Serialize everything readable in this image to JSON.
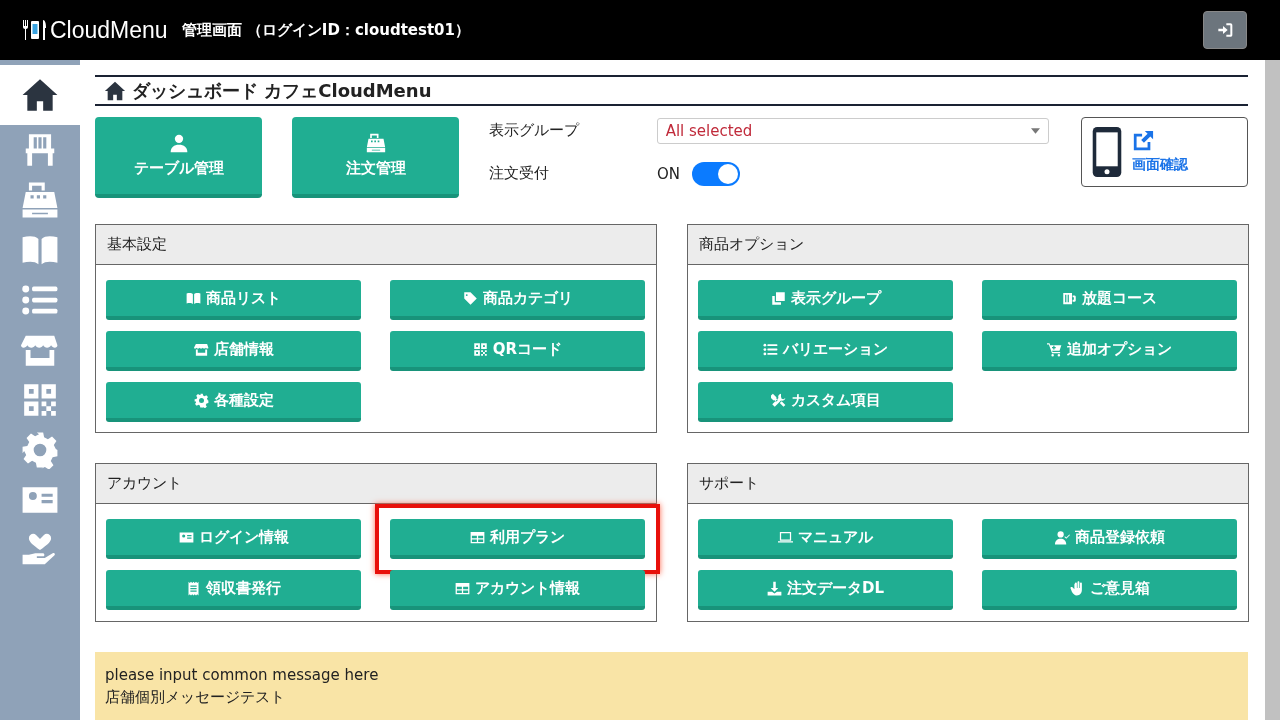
{
  "header": {
    "logo": "CloudMenu",
    "title": "管理画面 （ログインID：cloudtest01）"
  },
  "sidebar": {
    "items": [
      {
        "kind": "home",
        "selected": true
      },
      {
        "kind": "chair",
        "selected": false
      },
      {
        "kind": "register",
        "selected": false
      },
      {
        "kind": "book",
        "selected": false
      },
      {
        "kind": "list",
        "selected": false
      },
      {
        "kind": "store",
        "selected": false
      },
      {
        "kind": "qr",
        "selected": false
      },
      {
        "kind": "gear",
        "selected": false
      },
      {
        "kind": "idcard",
        "selected": false
      },
      {
        "kind": "heart",
        "selected": false
      }
    ]
  },
  "page_title": "ダッシュボード カフェCloudMenu",
  "quick_buttons": [
    {
      "kind": "user",
      "label": "テーブル管理"
    },
    {
      "kind": "register",
      "label": "注文管理"
    }
  ],
  "display_group": {
    "label": "表示グループ",
    "value": "All selected"
  },
  "order_accept": {
    "label": "注文受付",
    "state_text": "ON",
    "on": true
  },
  "preview": {
    "label": "画面確認"
  },
  "panels": [
    {
      "title": "基本設定",
      "buttons": [
        {
          "kind": "book",
          "label": "商品リスト",
          "highlighted": false
        },
        {
          "kind": "tag",
          "label": "商品カテゴリ",
          "highlighted": false
        },
        {
          "kind": "store",
          "label": "店舗情報",
          "highlighted": false
        },
        {
          "kind": "qr",
          "label": "QRコード",
          "highlighted": false
        },
        {
          "kind": "gear",
          "label": "各種設定",
          "highlighted": false
        }
      ]
    },
    {
      "title": "商品オプション",
      "buttons": [
        {
          "kind": "clone",
          "label": "表示グループ",
          "highlighted": false
        },
        {
          "kind": "mug",
          "label": "放題コース",
          "highlighted": false
        },
        {
          "kind": "list",
          "label": "バリエーション",
          "highlighted": false
        },
        {
          "kind": "cart",
          "label": "追加オプション",
          "highlighted": false
        },
        {
          "kind": "tools",
          "label": "カスタム項目",
          "highlighted": false
        }
      ]
    },
    {
      "title": "アカウント",
      "buttons": [
        {
          "kind": "idcard",
          "label": "ログイン情報",
          "highlighted": false
        },
        {
          "kind": "table",
          "label": "利用プラン",
          "highlighted": true
        },
        {
          "kind": "receipt",
          "label": "領収書発行",
          "highlighted": false
        },
        {
          "kind": "table",
          "label": "アカウント情報",
          "highlighted": false
        }
      ]
    },
    {
      "title": "サポート",
      "buttons": [
        {
          "kind": "laptop",
          "label": "マニュアル",
          "highlighted": false
        },
        {
          "kind": "usercheck",
          "label": "商品登録依頼",
          "highlighted": false
        },
        {
          "kind": "download",
          "label": "注文データDL",
          "highlighted": false
        },
        {
          "kind": "hand",
          "label": "ご意見箱",
          "highlighted": false
        }
      ]
    }
  ],
  "messages": [
    "please input common message here",
    "店舗個別メッセージテスト"
  ]
}
